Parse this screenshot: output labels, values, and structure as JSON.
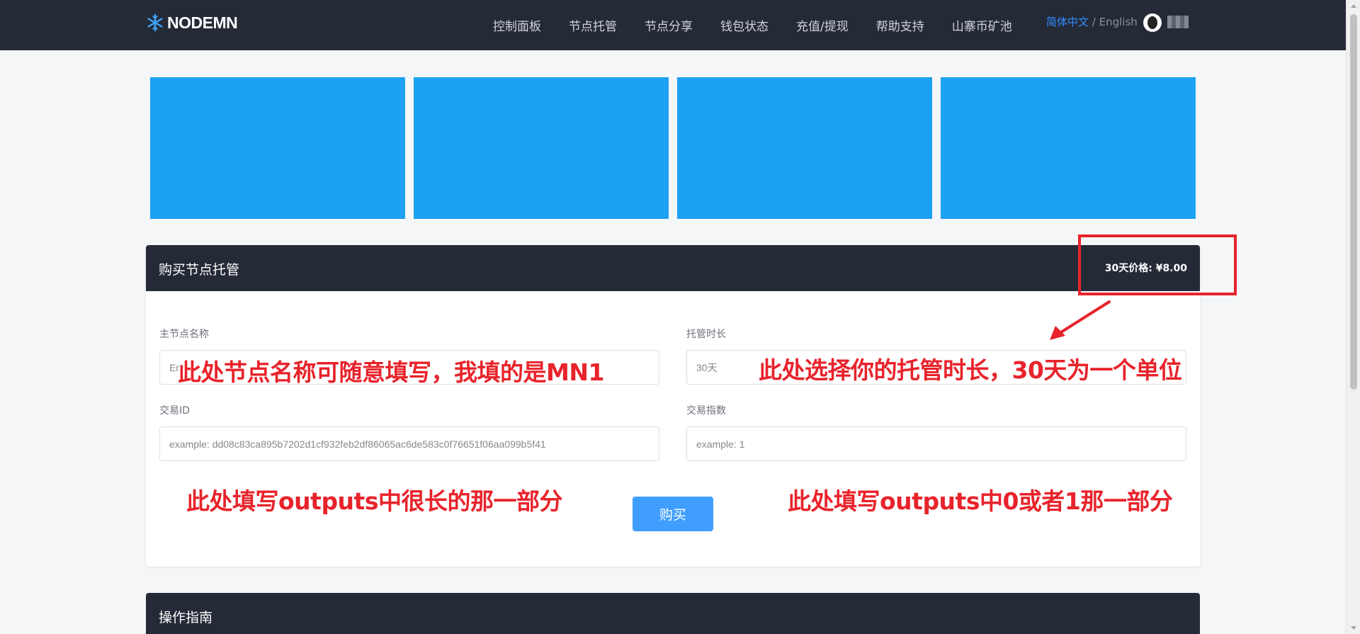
{
  "header": {
    "logo_text": "NODEMN",
    "nav": [
      "控制面板",
      "节点托管",
      "节点分享",
      "钱包状态",
      "充值/提现",
      "帮助支持",
      "山寨币矿池"
    ],
    "lang_active": "简体中文",
    "lang_sep": " / ",
    "lang_inactive": "English"
  },
  "colors": {
    "topbar": "#252a37",
    "banner": "#1da1f2",
    "primary_button": "#409eff",
    "annotation": "#e8232b",
    "lang_active": "#2f8fff"
  },
  "purchase": {
    "title": "购买节点托管",
    "price": "30天价格: ¥8.00",
    "name_label": "主节点名称",
    "name_value": "Er",
    "duration_label": "托管时长",
    "duration_value": "30天",
    "txid_label": "交易ID",
    "txid_placeholder": "example: dd08c83ca895b7202d1cf932feb2df86065ac6de583c0f76651f06aa099b5f41",
    "index_label": "交易指数",
    "index_placeholder": "example: 1",
    "buy_label": "购买"
  },
  "annotations": {
    "name_note": "此处节点名称可随意填写，我填的是MN1",
    "duration_note": "此处选择你的托管时长，30天为一个单位",
    "txid_note": "此处填写outputs中很长的那一部分",
    "index_note": "此处填写outputs中0或者1那一部分"
  },
  "guide": {
    "title": "操作指南"
  }
}
